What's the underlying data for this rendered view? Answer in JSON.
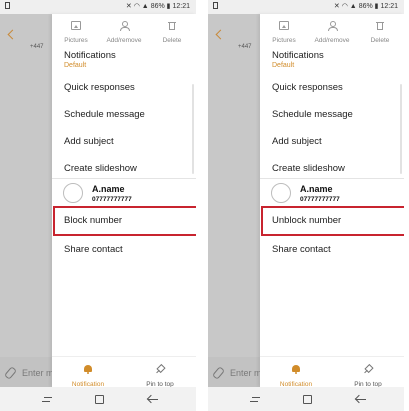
{
  "status_bar": {
    "battery": "86%",
    "time": "12:21"
  },
  "conversation": {
    "number": "+447",
    "input_placeholder": "Enter m"
  },
  "drawer": {
    "top_actions": [
      {
        "label": "Pictures",
        "icon": "pictures-icon"
      },
      {
        "label": "Add/remove",
        "icon": "person-icon"
      },
      {
        "label": "Delete",
        "icon": "trash-icon"
      }
    ],
    "notifications": {
      "label": "Notifications",
      "sub": "Default"
    },
    "quick_responses": "Quick responses",
    "schedule_message": "Schedule message",
    "add_subject": "Add subject",
    "create_slideshow": "Create slideshow",
    "contact": {
      "name": "A.name",
      "number": "07777777777"
    },
    "share_contact": "Share contact",
    "bottom_actions": [
      {
        "label": "Notification",
        "icon": "bell-icon"
      },
      {
        "label": "Pin to top",
        "icon": "pin-icon"
      }
    ]
  },
  "left_panel": {
    "highlighted_action": "Block number"
  },
  "right_panel": {
    "highlighted_action": "Unblock number"
  },
  "colors": {
    "accent": "#d18c2a",
    "highlight_border": "#c8242f"
  }
}
